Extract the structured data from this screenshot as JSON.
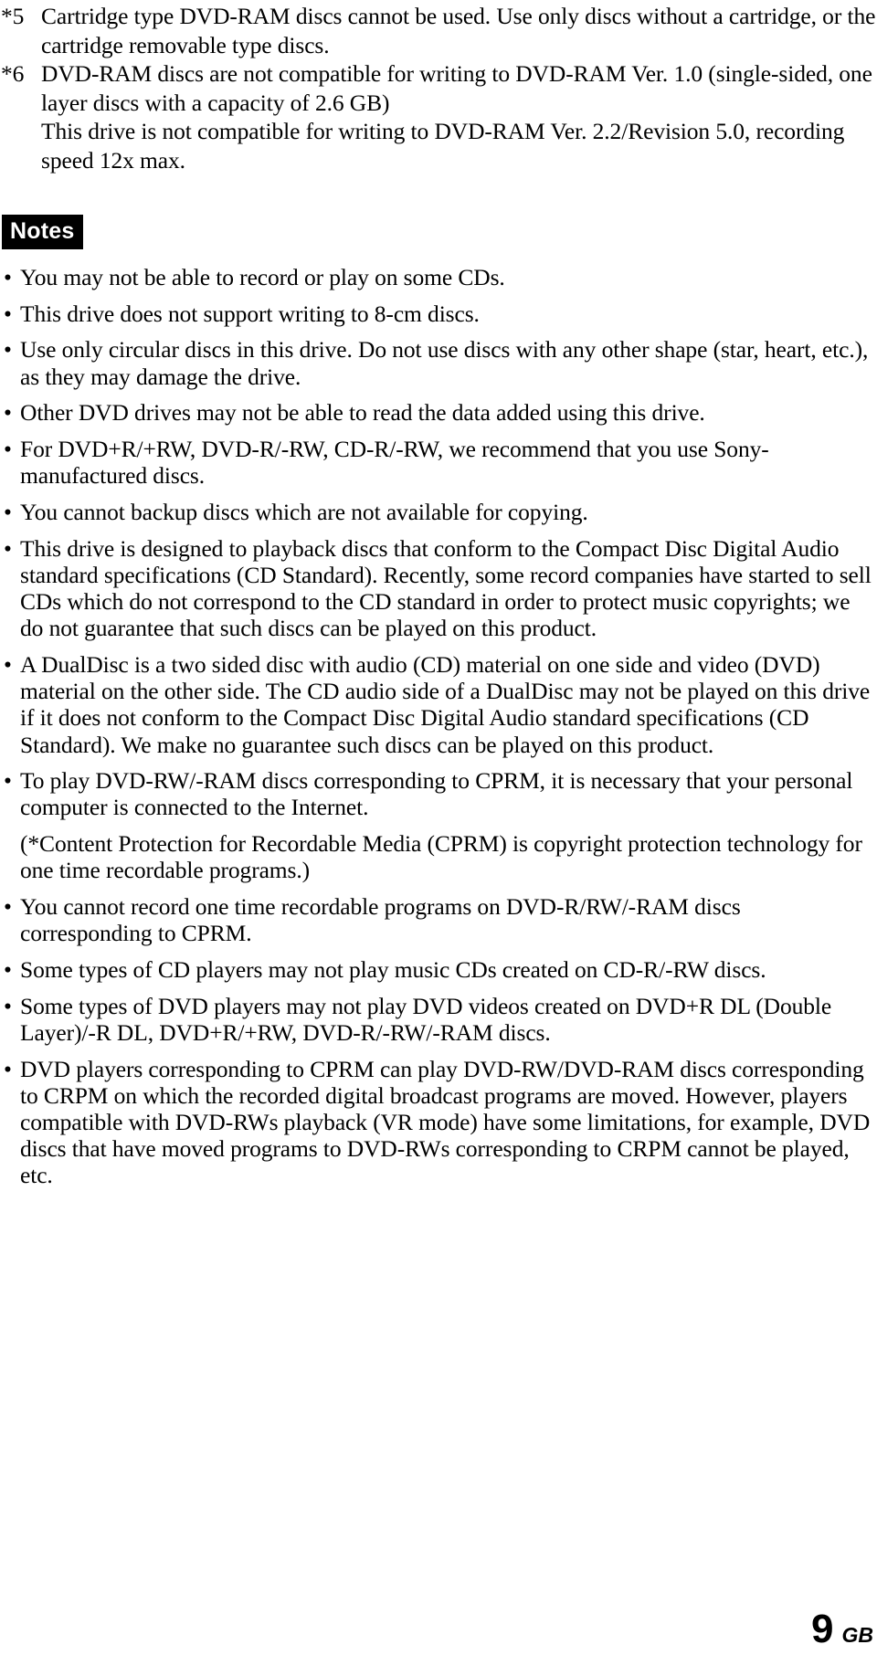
{
  "document": {
    "footnotes": [
      {
        "marker": "*5",
        "text": "Cartridge type DVD-RAM discs cannot be used. Use only discs without a cartridge, or the cartridge removable type discs."
      },
      {
        "marker": "*6",
        "text": "DVD-RAM discs are not compatible for writing to DVD-RAM Ver. 1.0 (single-sided, one layer discs with a capacity of 2.6 GB)",
        "extra": "This drive is not compatible for writing to DVD-RAM Ver. 2.2/Revision 5.0, recording speed 12x max."
      }
    ],
    "notes": {
      "heading": "Notes",
      "items": [
        {
          "bullet": true,
          "text": "You may not be able to record or play on some CDs."
        },
        {
          "bullet": true,
          "text": "This drive does not support writing to 8-cm discs."
        },
        {
          "bullet": true,
          "text": "Use only circular discs in this drive. Do not use discs with any other shape (star, heart, etc.), as they may damage the drive."
        },
        {
          "bullet": true,
          "text": "Other DVD drives may not be able to read the data added using this drive."
        },
        {
          "bullet": true,
          "text": "For DVD+R/+RW, DVD-R/-RW, CD-R/-RW, we recommend that you use Sony-manufactured discs."
        },
        {
          "bullet": true,
          "text": "You cannot backup discs which are not available for copying."
        },
        {
          "bullet": true,
          "text": "This drive is designed to playback discs that conform to the Compact Disc Digital Audio standard specifications (CD Standard). Recently, some record companies have started to sell CDs which do not correspond to the CD standard in order to protect music copyrights; we do not guarantee that such discs can be played on this product."
        },
        {
          "bullet": true,
          "text": "A DualDisc is a two sided disc with audio (CD) material on one side and video (DVD) material on the other side. The CD audio side of a DualDisc may not be played on this drive if it does not conform to the Compact Disc Digital Audio standard specifications (CD Standard). We make no guarantee such discs can be played on this product."
        },
        {
          "bullet": true,
          "text": "To play DVD-RW/-RAM discs corresponding to CPRM, it is necessary that your personal computer is connected to the Internet."
        },
        {
          "bullet": false,
          "text": "(*Content Protection for Recordable Media (CPRM) is copyright protection technology for one time recordable programs.)"
        },
        {
          "bullet": true,
          "text": "You cannot record one time recordable programs on DVD-R/RW/-RAM discs corresponding to CPRM."
        },
        {
          "bullet": true,
          "text": "Some types of CD players may not play music CDs created on CD-R/-RW discs."
        },
        {
          "bullet": true,
          "text": "Some types of DVD players may not play DVD videos created on DVD+R DL (Double Layer)/-R DL, DVD+R/+RW, DVD-R/-RW/-RAM discs."
        },
        {
          "bullet": true,
          "text": "DVD players corresponding to CPRM can play DVD-RW/DVD-RAM discs corresponding to CRPM on which the recorded digital broadcast programs are moved. However, players compatible with DVD-RWs playback (VR mode) have some limitations, for example, DVD discs that have moved programs to DVD-RWs corresponding to CRPM cannot be played, etc."
        }
      ],
      "bullet_glyph": "•"
    },
    "footer": {
      "page_number": "9",
      "region": "GB"
    }
  }
}
